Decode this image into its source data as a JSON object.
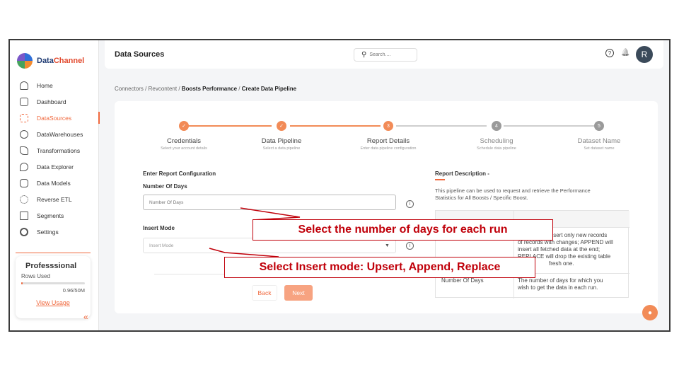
{
  "sidebar": {
    "logo_part1": "Data",
    "logo_part2": "Channel",
    "items": [
      {
        "label": "Home"
      },
      {
        "label": "Dashboard"
      },
      {
        "label": "DataSources"
      },
      {
        "label": "DataWarehouses"
      },
      {
        "label": "Transformations"
      },
      {
        "label": "Data Explorer"
      },
      {
        "label": "Data Models"
      },
      {
        "label": "Reverse ETL"
      },
      {
        "label": "Segments"
      },
      {
        "label": "Settings"
      }
    ],
    "plan": {
      "title": "Professsional",
      "rows_label": "Rows Used",
      "usage": "0.96/50M",
      "usage_fraction": 0.0192,
      "link": "View Usage"
    },
    "collapse_glyph": "«"
  },
  "header": {
    "title": "Data Sources",
    "search_placeholder": "Search....",
    "help_glyph": "?",
    "bell_glyph": "🔔",
    "avatar_letter": "R"
  },
  "breadcrumb": {
    "items": [
      "Connectors",
      "Revcontent",
      "Boosts Performance",
      "Create Data Pipeline"
    ],
    "separator": "/"
  },
  "stepper": {
    "steps": [
      {
        "marker": "✓",
        "title": "Credentials",
        "subtitle": "Select your account details",
        "state": "done"
      },
      {
        "marker": "✓",
        "title": "Data Pipeline",
        "subtitle": "Select a data pipeline",
        "state": "done"
      },
      {
        "marker": "3",
        "title": "Report Details",
        "subtitle": "Enter data pipeline configuration",
        "state": "current"
      },
      {
        "marker": "4",
        "title": "Scheduling",
        "subtitle": "Schedule data pipeline",
        "state": "todo"
      },
      {
        "marker": "5",
        "title": "Dataset Name",
        "subtitle": "Set dataset name",
        "state": "todo"
      }
    ]
  },
  "form": {
    "section_title": "Enter Report Configuration",
    "days_label": "Number Of Days",
    "days_placeholder": "Number Of Days",
    "insert_label": "Insert Mode",
    "insert_placeholder": "Insert Mode",
    "info_glyph": "i",
    "caret_glyph": "▼",
    "back_label": "Back",
    "next_label": "Next"
  },
  "description": {
    "title": "Report Description -",
    "text_line1": "This pipeline can be used to request and retrieve the Performance",
    "text_line2": "Statistics for All Boosts / Specific Boost.",
    "row1_col2_line1": "insert only new records",
    "row1_col2_line2": "of records with changes; APPEND will",
    "row1_col2_line3": "insert all fetched data at the end;",
    "row1_col2_line4": "REPLACE will drop the existing table",
    "row1_col2_line5": "fresh one.",
    "row2_col1": "Number Of Days",
    "row2_col2_line1": "The number of days for which you",
    "row2_col2_line2": "wish to get the data in each run."
  },
  "callouts": {
    "days": "Select the number of days for each run",
    "insert": "Select Insert mode: Upsert, Append, Replace"
  },
  "colors": {
    "accent": "#f0683d",
    "callout": "#c0000a"
  }
}
